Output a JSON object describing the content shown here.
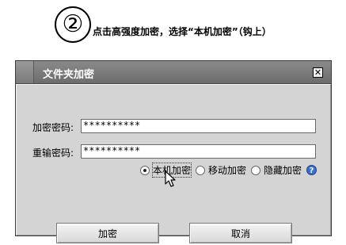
{
  "header": {
    "step": "②",
    "instruction": "点击高强度加密，选择“本机加密”（钩上）"
  },
  "dialog": {
    "title": "文件夹加密",
    "close_glyph": "✕",
    "password_label": "加密密码:",
    "password_value": "**********",
    "confirm_label": "重输密码:",
    "confirm_value": "**********",
    "options": [
      {
        "label": "本机加密",
        "selected": true
      },
      {
        "label": "移动加密",
        "selected": false
      },
      {
        "label": "隐藏加密",
        "selected": false
      }
    ],
    "help_glyph": "?",
    "encrypt_button": "加密",
    "cancel_button": "取消"
  }
}
